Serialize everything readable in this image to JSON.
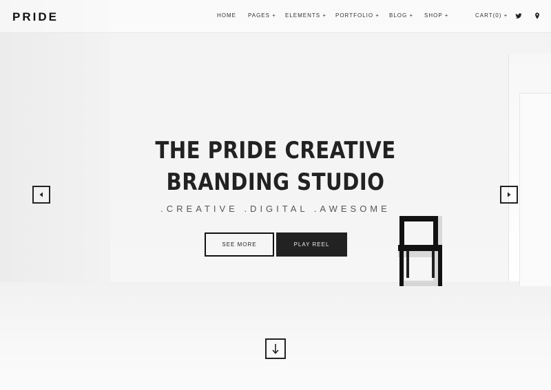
{
  "brand": {
    "logo": "PRIDE"
  },
  "nav": {
    "items": [
      "HOME",
      "PAGES +",
      "ELEMENTS +",
      "PORTFOLIO +",
      "BLOG +",
      "SHOP +"
    ],
    "cart": "CART(0) +",
    "icons": [
      "twitter-icon",
      "map-pin-icon"
    ]
  },
  "hero": {
    "title_line1": "THE PRIDE CREATIVE",
    "title_line2": "BRANDING STUDIO",
    "subtitle": ".CREATIVE .DIGITAL .AWESOME",
    "primary_button": "SEE MORE",
    "secondary_button": "PLAY REEL"
  },
  "slider": {
    "prev_icon": "arrow-left-icon",
    "next_icon": "arrow-right-icon",
    "scroll_icon": "arrow-down-icon"
  },
  "colors": {
    "text": "#222222",
    "button_dark": "#222222",
    "background": "#f4f4f4"
  }
}
